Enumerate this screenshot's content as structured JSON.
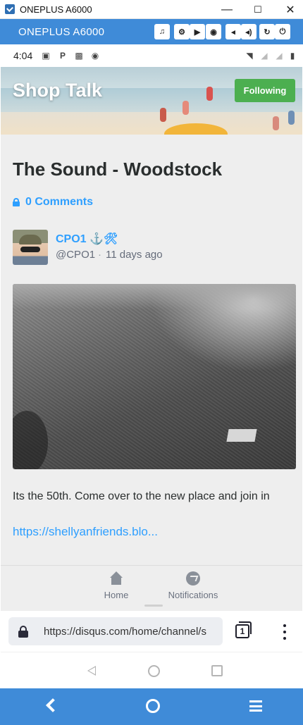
{
  "window": {
    "title": "ONEPLUS A6000",
    "minimize": "—",
    "maximize": "☐",
    "close": "✕"
  },
  "scrcpy": {
    "title": "ONEPLUS A6000",
    "buttons": [
      "headphones-icon",
      "gear-icon",
      "camera-video-icon",
      "screenshot-icon",
      "volume-down-icon",
      "volume-up-icon",
      "rotate-icon",
      "power-icon"
    ]
  },
  "statusbar": {
    "time": "4:04"
  },
  "channel": {
    "name": "Shop Talk",
    "follow_label": "Following"
  },
  "post": {
    "title": "The Sound - Woodstock",
    "comments_label": "0 Comments",
    "author_name": "CPO1 ⚓🛠",
    "author_handle": "@CPO1",
    "separator": "·",
    "time_ago": "11 days ago",
    "text": "Its the 50th. Come over to the new place and join in",
    "link": "https://shellyanfriends.blo..."
  },
  "bottom_nav": {
    "home_label": "Home",
    "notifications_label": "Notifications"
  },
  "browser": {
    "url": "https://disqus.com/home/channel/s",
    "tab_count": "1"
  },
  "colors": {
    "accent": "#2e9fff",
    "follow_green": "#4caf50",
    "scrcpy_blue": "#3f8bd8"
  }
}
